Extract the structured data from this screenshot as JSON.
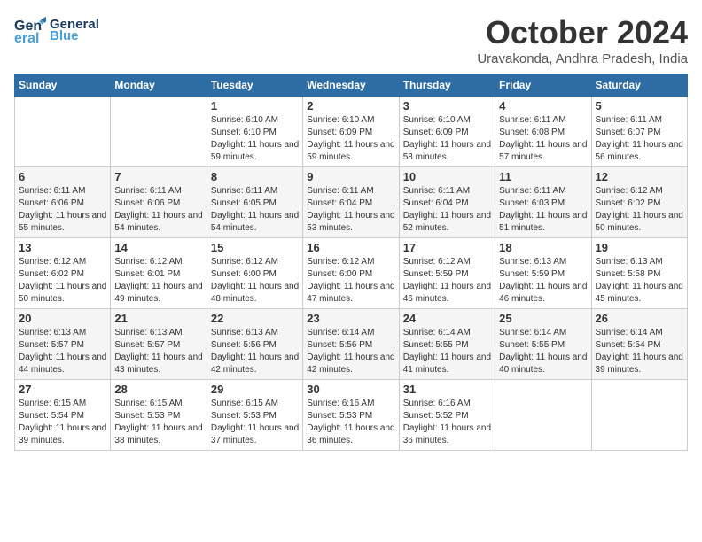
{
  "logo": {
    "line1": "General",
    "line2": "Blue"
  },
  "header": {
    "title": "October 2024",
    "location": "Uravakonda, Andhra Pradesh, India"
  },
  "days_of_week": [
    "Sunday",
    "Monday",
    "Tuesday",
    "Wednesday",
    "Thursday",
    "Friday",
    "Saturday"
  ],
  "weeks": [
    [
      {
        "day": "",
        "info": ""
      },
      {
        "day": "",
        "info": ""
      },
      {
        "day": "1",
        "info": "Sunrise: 6:10 AM\nSunset: 6:10 PM\nDaylight: 11 hours and 59 minutes."
      },
      {
        "day": "2",
        "info": "Sunrise: 6:10 AM\nSunset: 6:09 PM\nDaylight: 11 hours and 59 minutes."
      },
      {
        "day": "3",
        "info": "Sunrise: 6:10 AM\nSunset: 6:09 PM\nDaylight: 11 hours and 58 minutes."
      },
      {
        "day": "4",
        "info": "Sunrise: 6:11 AM\nSunset: 6:08 PM\nDaylight: 11 hours and 57 minutes."
      },
      {
        "day": "5",
        "info": "Sunrise: 6:11 AM\nSunset: 6:07 PM\nDaylight: 11 hours and 56 minutes."
      }
    ],
    [
      {
        "day": "6",
        "info": "Sunrise: 6:11 AM\nSunset: 6:06 PM\nDaylight: 11 hours and 55 minutes."
      },
      {
        "day": "7",
        "info": "Sunrise: 6:11 AM\nSunset: 6:06 PM\nDaylight: 11 hours and 54 minutes."
      },
      {
        "day": "8",
        "info": "Sunrise: 6:11 AM\nSunset: 6:05 PM\nDaylight: 11 hours and 54 minutes."
      },
      {
        "day": "9",
        "info": "Sunrise: 6:11 AM\nSunset: 6:04 PM\nDaylight: 11 hours and 53 minutes."
      },
      {
        "day": "10",
        "info": "Sunrise: 6:11 AM\nSunset: 6:04 PM\nDaylight: 11 hours and 52 minutes."
      },
      {
        "day": "11",
        "info": "Sunrise: 6:11 AM\nSunset: 6:03 PM\nDaylight: 11 hours and 51 minutes."
      },
      {
        "day": "12",
        "info": "Sunrise: 6:12 AM\nSunset: 6:02 PM\nDaylight: 11 hours and 50 minutes."
      }
    ],
    [
      {
        "day": "13",
        "info": "Sunrise: 6:12 AM\nSunset: 6:02 PM\nDaylight: 11 hours and 50 minutes."
      },
      {
        "day": "14",
        "info": "Sunrise: 6:12 AM\nSunset: 6:01 PM\nDaylight: 11 hours and 49 minutes."
      },
      {
        "day": "15",
        "info": "Sunrise: 6:12 AM\nSunset: 6:00 PM\nDaylight: 11 hours and 48 minutes."
      },
      {
        "day": "16",
        "info": "Sunrise: 6:12 AM\nSunset: 6:00 PM\nDaylight: 11 hours and 47 minutes."
      },
      {
        "day": "17",
        "info": "Sunrise: 6:12 AM\nSunset: 5:59 PM\nDaylight: 11 hours and 46 minutes."
      },
      {
        "day": "18",
        "info": "Sunrise: 6:13 AM\nSunset: 5:59 PM\nDaylight: 11 hours and 46 minutes."
      },
      {
        "day": "19",
        "info": "Sunrise: 6:13 AM\nSunset: 5:58 PM\nDaylight: 11 hours and 45 minutes."
      }
    ],
    [
      {
        "day": "20",
        "info": "Sunrise: 6:13 AM\nSunset: 5:57 PM\nDaylight: 11 hours and 44 minutes."
      },
      {
        "day": "21",
        "info": "Sunrise: 6:13 AM\nSunset: 5:57 PM\nDaylight: 11 hours and 43 minutes."
      },
      {
        "day": "22",
        "info": "Sunrise: 6:13 AM\nSunset: 5:56 PM\nDaylight: 11 hours and 42 minutes."
      },
      {
        "day": "23",
        "info": "Sunrise: 6:14 AM\nSunset: 5:56 PM\nDaylight: 11 hours and 42 minutes."
      },
      {
        "day": "24",
        "info": "Sunrise: 6:14 AM\nSunset: 5:55 PM\nDaylight: 11 hours and 41 minutes."
      },
      {
        "day": "25",
        "info": "Sunrise: 6:14 AM\nSunset: 5:55 PM\nDaylight: 11 hours and 40 minutes."
      },
      {
        "day": "26",
        "info": "Sunrise: 6:14 AM\nSunset: 5:54 PM\nDaylight: 11 hours and 39 minutes."
      }
    ],
    [
      {
        "day": "27",
        "info": "Sunrise: 6:15 AM\nSunset: 5:54 PM\nDaylight: 11 hours and 39 minutes."
      },
      {
        "day": "28",
        "info": "Sunrise: 6:15 AM\nSunset: 5:53 PM\nDaylight: 11 hours and 38 minutes."
      },
      {
        "day": "29",
        "info": "Sunrise: 6:15 AM\nSunset: 5:53 PM\nDaylight: 11 hours and 37 minutes."
      },
      {
        "day": "30",
        "info": "Sunrise: 6:16 AM\nSunset: 5:53 PM\nDaylight: 11 hours and 36 minutes."
      },
      {
        "day": "31",
        "info": "Sunrise: 6:16 AM\nSunset: 5:52 PM\nDaylight: 11 hours and 36 minutes."
      },
      {
        "day": "",
        "info": ""
      },
      {
        "day": "",
        "info": ""
      }
    ]
  ]
}
